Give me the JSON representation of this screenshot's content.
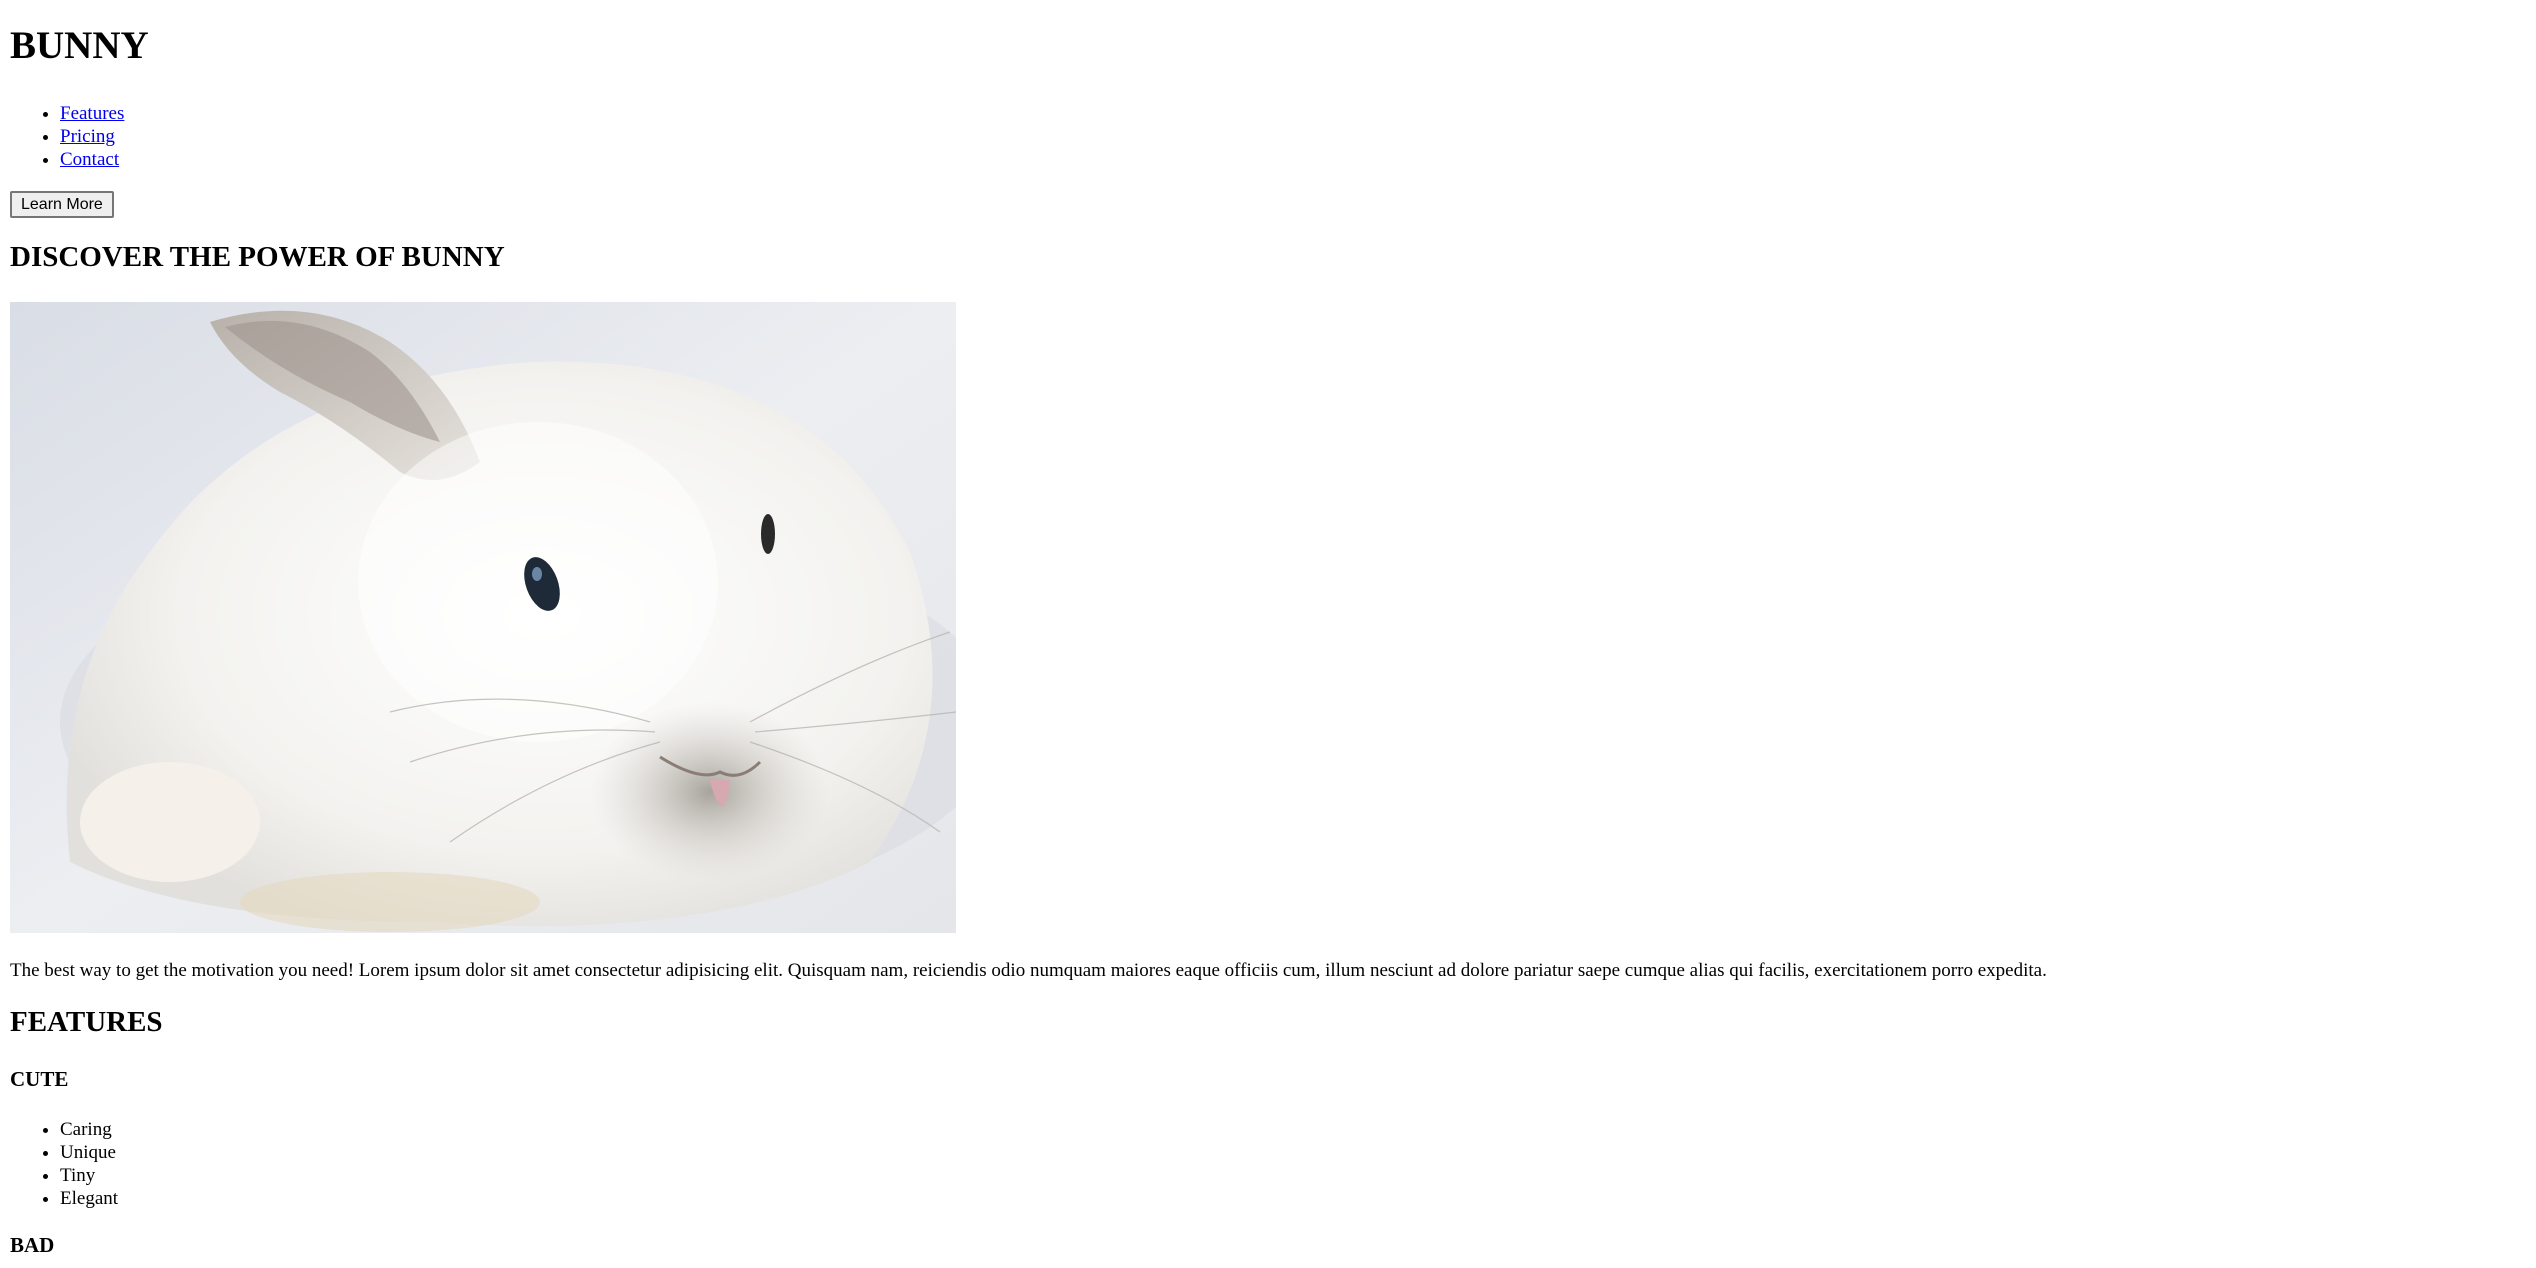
{
  "header": {
    "title": "BUNNY",
    "nav": [
      {
        "label": "Features"
      },
      {
        "label": "Pricing"
      },
      {
        "label": "Contact"
      }
    ],
    "cta_label": "Learn More"
  },
  "hero": {
    "title": "DISCOVER THE POWER OF BUNNY",
    "image_icon": "bunny-photo",
    "intro": "The best way to get the motivation you need! Lorem ipsum dolor sit amet consectetur adipisicing elit. Quisquam nam, reiciendis odio numquam maiores eaque officiis cum, illum nesciunt ad dolore pariatur saepe cumque alias qui facilis, exercitationem porro expedita."
  },
  "features": {
    "title": "FEATURES",
    "groups": [
      {
        "title": "CUTE",
        "items": [
          "Caring",
          "Unique",
          "Tiny",
          "Elegant"
        ]
      },
      {
        "title": "BAD",
        "items": []
      }
    ]
  },
  "colors": {
    "link": "#0000ee",
    "text": "#000000",
    "background": "#ffffff"
  }
}
